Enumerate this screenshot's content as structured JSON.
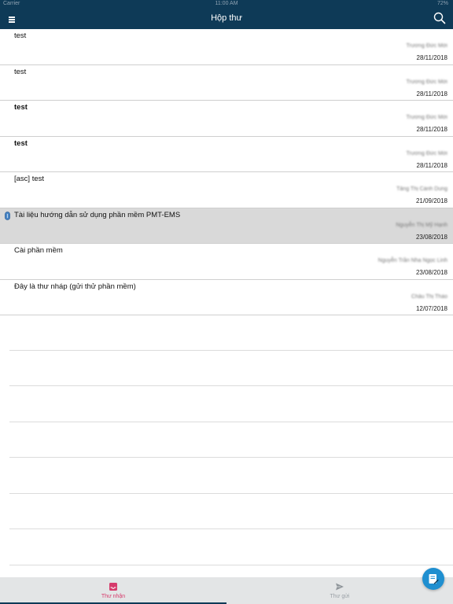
{
  "status_bar": {
    "carrier": "Carrier",
    "time": "11:00 AM",
    "battery": "72%"
  },
  "header": {
    "title": "Hộp thư"
  },
  "messages": [
    {
      "subject": "test",
      "sender": "Trương Đức Mời",
      "date": "28/11/2018",
      "bold": false,
      "highlight": false,
      "attachment": false
    },
    {
      "subject": "test",
      "sender": "Trương Đức Mời",
      "date": "28/11/2018",
      "bold": false,
      "highlight": false,
      "attachment": false
    },
    {
      "subject": "test",
      "sender": "Trương Đức Mời",
      "date": "28/11/2018",
      "bold": true,
      "highlight": false,
      "attachment": false
    },
    {
      "subject": "test",
      "sender": "Trương Đức Mời",
      "date": "28/11/2018",
      "bold": true,
      "highlight": false,
      "attachment": false
    },
    {
      "subject": "[asc] test",
      "sender": "Tăng Thị Cảnh Dung",
      "date": "21/09/2018",
      "bold": false,
      "highlight": false,
      "attachment": false
    },
    {
      "subject": "Tài liệu hướng dẫn sử dụng phần mềm PMT-EMS",
      "sender": "Nguyễn Thị Mỹ Hạnh",
      "date": "23/08/2018",
      "bold": false,
      "highlight": true,
      "attachment": true
    },
    {
      "subject": "Cài phần mềm",
      "sender": "Nguyễn Trần Nha Ngọc Linh",
      "date": "23/08/2018",
      "bold": false,
      "highlight": false,
      "attachment": false
    },
    {
      "subject": "Đây là thư nháp (gửi thử phần mềm)",
      "sender": "Châu Thị Thảo",
      "date": "12/07/2018",
      "bold": false,
      "highlight": false,
      "attachment": false
    }
  ],
  "tabs": {
    "inbox": {
      "label": "Thư nhận",
      "icon": "inbox-icon",
      "active": true
    },
    "sent": {
      "label": "Thư gửi",
      "icon": "send-icon",
      "active": false
    }
  },
  "icons": {
    "menu": "menu-icon",
    "search": "search-icon",
    "compose": "compose-icon",
    "attachment": "paperclip-icon"
  },
  "colors": {
    "header_bg": "#0e3a57",
    "active_tab": "#d63a6b",
    "highlight_row": "#d9d9d9",
    "fab": "#1f8fd0"
  }
}
